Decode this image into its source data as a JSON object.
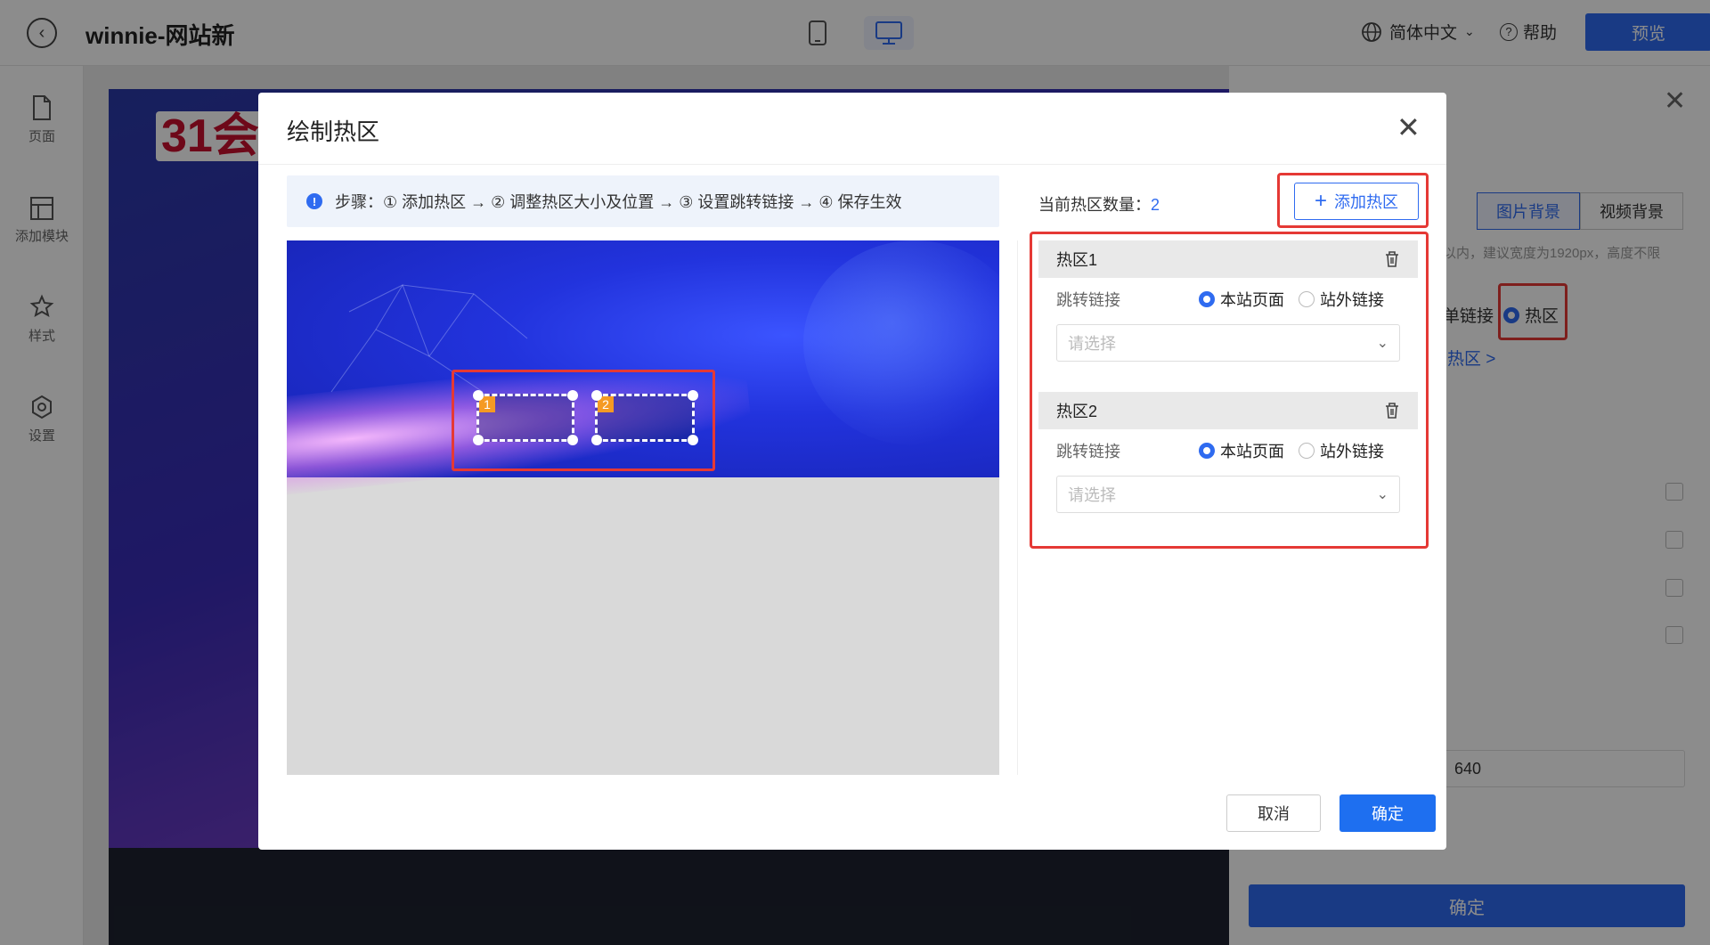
{
  "header": {
    "site_title": "winnie-网站新",
    "language": "简体中文",
    "help": "帮助",
    "preview": "预览"
  },
  "sidebar": {
    "items": [
      {
        "label": "页面",
        "icon": "page-icon"
      },
      {
        "label": "添加模块",
        "icon": "module-icon"
      },
      {
        "label": "样式",
        "icon": "style-icon"
      },
      {
        "label": "设置",
        "icon": "settings-icon"
      }
    ]
  },
  "canvas": {
    "logo_text": "31会"
  },
  "right_panel": {
    "tabs": [
      "图片背景",
      "视频背景"
    ],
    "hint": "以内，建议宽度为1920px，高度不限",
    "link_label": "单链接",
    "hotzone_option": "热区",
    "hotzone_link": "热区 >",
    "input_value": "640",
    "confirm": "确定"
  },
  "modal": {
    "title": "绘制热区",
    "steps": "步骤：① 添加热区 → ② 调整热区大小及位置 → ③ 设置跳转链接 → ④ 保存生效",
    "count_label": "当前热区数量：",
    "count_value": "2",
    "add_button": "添加热区",
    "hotzones": [
      {
        "name": "热区1",
        "number": "1",
        "link_label": "跳转链接",
        "option_internal": "本站页面",
        "option_external": "站外链接",
        "selected": "本站页面",
        "placeholder": "请选择"
      },
      {
        "name": "热区2",
        "number": "2",
        "link_label": "跳转链接",
        "option_internal": "本站页面",
        "option_external": "站外链接",
        "selected": "本站页面",
        "placeholder": "请选择"
      }
    ],
    "cancel": "取消",
    "ok": "确定"
  },
  "colors": {
    "primary": "#2f6bf0",
    "highlight": "#e53935",
    "badge": "#f59a23"
  }
}
